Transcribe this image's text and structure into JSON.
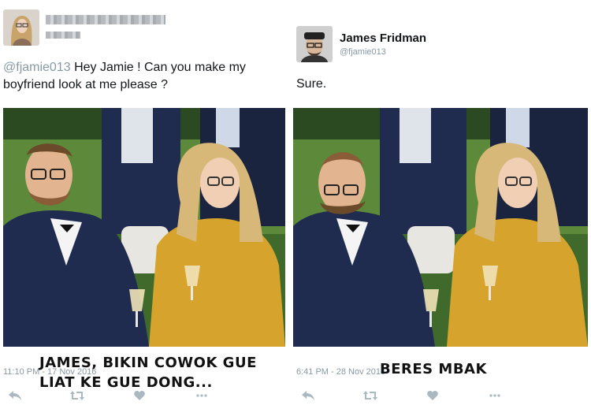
{
  "left_tweet": {
    "handle_mention": "@fjamie013",
    "text": " Hey Jamie ! Can you make my boyfriend look at me please ?",
    "timestamp": "11:10 PM - 17 Nov 2016",
    "caption": "JAMES, BIKIN COWOK GUE LIAT KE GUE DONG..."
  },
  "right_tweet": {
    "name": "James Fridman",
    "handle": "@fjamie013",
    "text": "Sure.",
    "timestamp": "6:41 PM - 28 Nov 2016",
    "caption": "BERES MBAK"
  },
  "icons": [
    "reply-icon",
    "retweet-icon",
    "like-icon",
    "more-icon"
  ],
  "colors": {
    "text": "#14171a",
    "muted": "#8899a6",
    "action_icon": "#aab8c2",
    "grass": "#3f6a2c",
    "suit": "#1f2c4f",
    "dress": "#d6a32c"
  }
}
